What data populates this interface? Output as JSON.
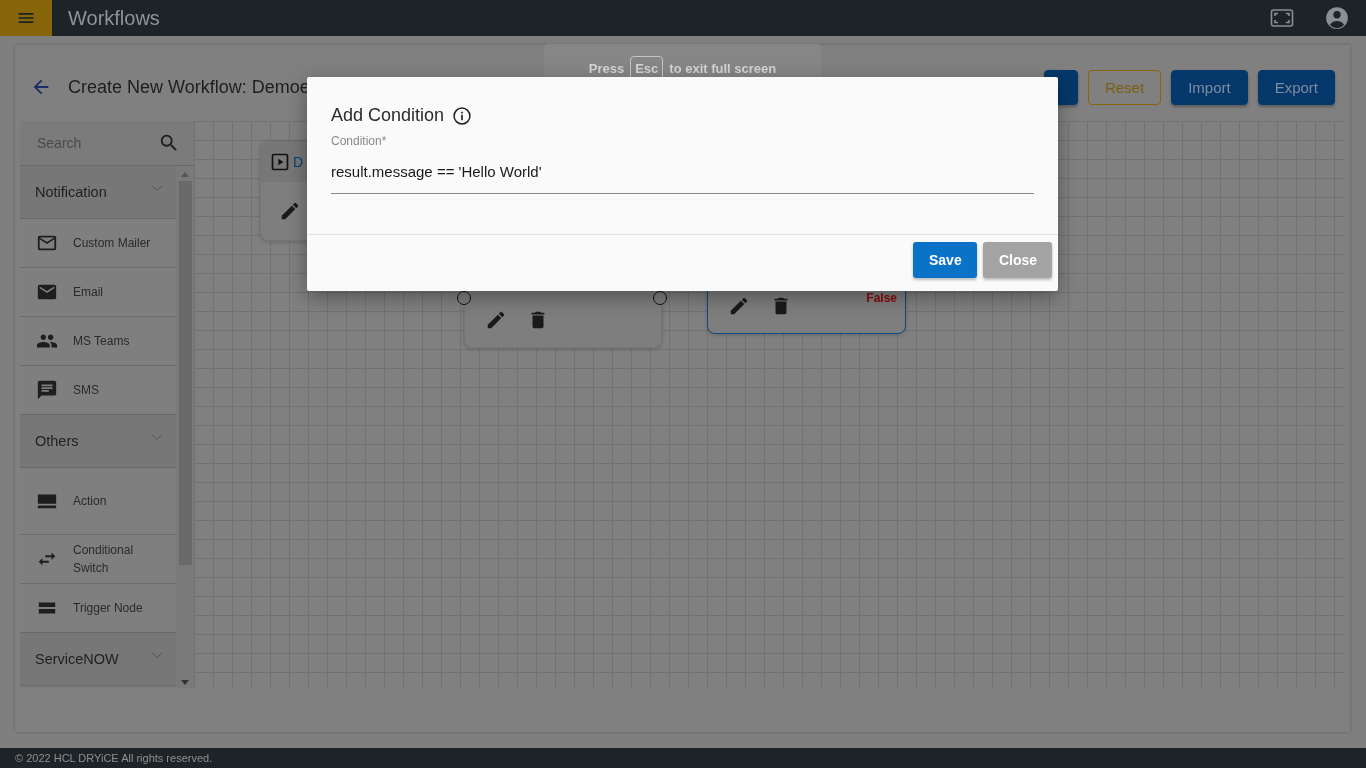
{
  "app_bar": {
    "title": "Workflows"
  },
  "fullscreen_notice": {
    "before": "Press",
    "key": "Esc",
    "after": "to exit full screen"
  },
  "page": {
    "title": "Create New Workflow: Demoe",
    "buttons": [
      {
        "kind": "primary"
      },
      {
        "label": "Reset",
        "kind": "outline"
      },
      {
        "label": "Import",
        "kind": "primary"
      },
      {
        "label": "Export",
        "kind": "primary"
      }
    ]
  },
  "palette": {
    "search_placeholder": "Search",
    "groups": [
      {
        "label": "Notification",
        "items": [
          {
            "label": "Custom Mailer",
            "kind": "mail-outline"
          },
          {
            "label": "Email",
            "kind": "mail"
          },
          {
            "label": "MS Teams",
            "kind": "people"
          },
          {
            "label": "SMS",
            "kind": "chat"
          }
        ]
      },
      {
        "label": "Others",
        "items": [
          {
            "label": "Action",
            "kind": "action"
          },
          {
            "label": "Conditional Switch",
            "kind": "switch"
          },
          {
            "label": "Trigger Node",
            "kind": "trigger"
          }
        ]
      },
      {
        "label": "ServiceNOW"
      }
    ]
  },
  "canvas": {
    "nodes": [
      {
        "kind": "trigger",
        "title": "D",
        "selected": false
      },
      {
        "kind": "action",
        "selected": false
      },
      {
        "kind": "condition",
        "branch_label": "False",
        "selected": true
      }
    ]
  },
  "dialog": {
    "title": "Add Condition",
    "field": {
      "label": "Condition*",
      "value": "result.message == 'Hello World'"
    },
    "buttons": [
      {
        "label": "Save",
        "kind": "primary"
      },
      {
        "label": "Close",
        "kind": "secondary"
      }
    ]
  },
  "footer": "© 2022 HCL DRYiCE All rights reserved."
}
